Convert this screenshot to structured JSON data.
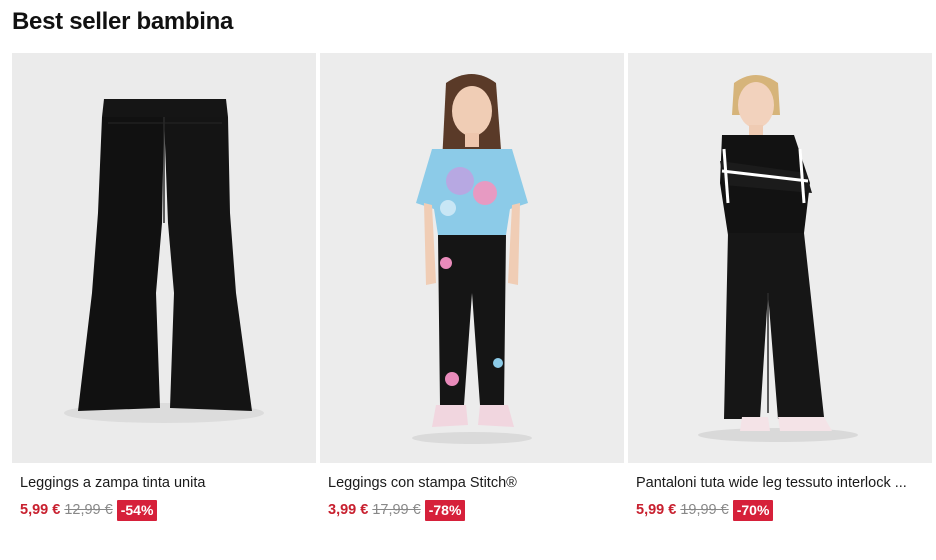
{
  "section": {
    "title": "Best seller bambina"
  },
  "colors": {
    "price": "#c8202f",
    "badge_bg": "#d6203a",
    "old_price": "#888888",
    "image_bg": "#e9e9e9"
  },
  "products": [
    {
      "name": "Leggings a zampa tinta unita",
      "price": "5,99 €",
      "old_price": "12,99 €",
      "discount": "-54%",
      "image": "black-flared-leggings-photo"
    },
    {
      "name": "Leggings con stampa Stitch®",
      "price": "3,99 €",
      "old_price": "17,99 €",
      "discount": "-78%",
      "image": "girl-wearing-stitch-leggings-photo"
    },
    {
      "name": "Pantaloni tuta wide leg tessuto interlock ...",
      "price": "5,99 €",
      "old_price": "19,99 €",
      "discount": "-70%",
      "image": "girl-wearing-wide-leg-pants-photo"
    }
  ]
}
